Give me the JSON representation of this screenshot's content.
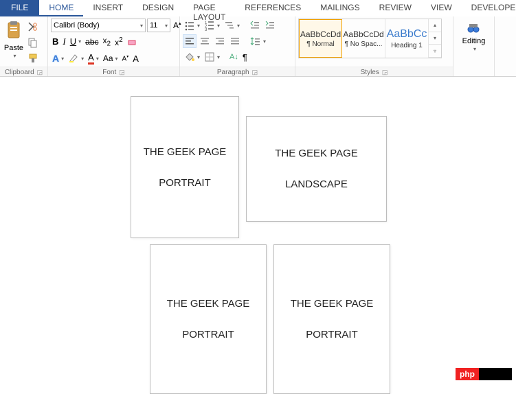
{
  "tabs": {
    "file": "FILE",
    "home": "HOME",
    "insert": "INSERT",
    "design": "DESIGN",
    "page": "PAGE LAYOUT",
    "ref": "REFERENCES",
    "mail": "MAILINGS",
    "review": "REVIEW",
    "view": "VIEW",
    "dev": "DEVELOPER"
  },
  "clipboard": {
    "paste": "Paste",
    "label": "Clipboard"
  },
  "font": {
    "name": "Calibri (Body)",
    "size": "11",
    "label": "Font"
  },
  "para": {
    "label": "Paragraph"
  },
  "styles": {
    "label": "Styles",
    "s1": "AaBbCcDd",
    "s1n": "¶ Normal",
    "s2": "AaBbCcDd",
    "s2n": "¶ No Spac...",
    "s3": "AaBbCc",
    "s3n": "Heading 1"
  },
  "edit": {
    "label": "Editing"
  },
  "pages": {
    "p1a": "THE GEEK PAGE",
    "p1b": "PORTRAIT",
    "p2a": "THE GEEK PAGE",
    "p2b": "LANDSCAPE",
    "p3a": "THE GEEK PAGE",
    "p3b": "PORTRAIT",
    "p4a": "THE GEEK PAGE",
    "p4b": "PORTRAIT"
  },
  "wm": "php"
}
